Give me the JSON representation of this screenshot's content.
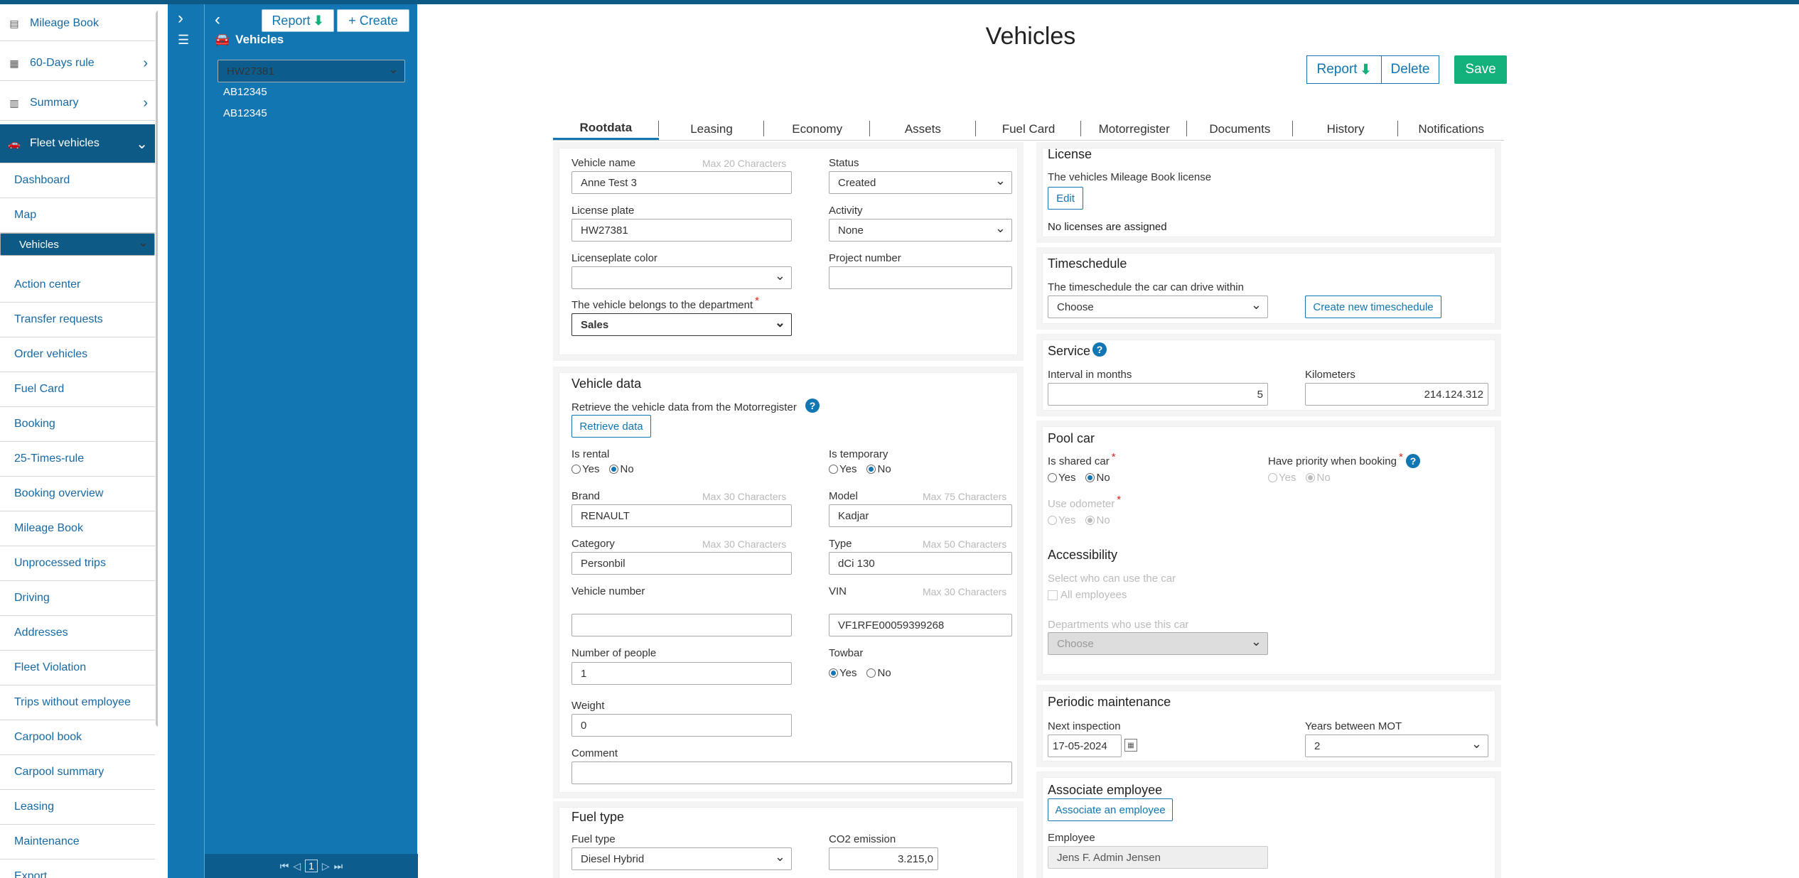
{
  "sidebar": {
    "items": [
      {
        "label": "Mileage Book",
        "icon": "book-icon"
      },
      {
        "label": "60-Days rule",
        "icon": "calendar-60-icon"
      },
      {
        "label": "Summary",
        "icon": "bar-chart-icon"
      },
      {
        "label": "Fleet vehicles",
        "icon": "car-icon"
      }
    ],
    "sub_items": [
      "Dashboard",
      "Map",
      "Vehicles",
      "Action center",
      "Transfer requests",
      "Order vehicles",
      "Fuel Card",
      "Booking",
      "25-Times-rule",
      "Booking overview",
      "Mileage Book",
      "Unprocessed trips",
      "Driving",
      "Addresses",
      "Fleet Violation",
      "Trips without employee",
      "Carpool book",
      "Carpool summary",
      "Leasing",
      "Maintenance",
      "Export"
    ]
  },
  "list_panel": {
    "report_label": "Report",
    "create_label": "+ Create",
    "title": "Vehicles",
    "rows": [
      "HW27381",
      "AB12345",
      "AB12345"
    ],
    "page": "1"
  },
  "main": {
    "title": "Vehicles",
    "report_label": "Report",
    "delete_label": "Delete",
    "save_label": "Save",
    "tabs": [
      "Rootdata",
      "Leasing",
      "Economy",
      "Assets",
      "Fuel Card",
      "Motorregister",
      "Documents",
      "History",
      "Notifications"
    ]
  },
  "rootdata": {
    "vehicle_name_label": "Vehicle name",
    "vehicle_name_hint": "Max 20 Characters",
    "vehicle_name": "Anne Test 3",
    "status_label": "Status",
    "status": "Created",
    "license_plate_label": "License plate",
    "license_plate": "HW27381",
    "activity_label": "Activity",
    "activity": "None",
    "plate_color_label": "Licenseplate color",
    "project_number_label": "Project number",
    "department_label": "The vehicle belongs to the department",
    "department": "Sales"
  },
  "vehicle_data": {
    "title": "Vehicle data",
    "retrieve_text": "Retrieve the vehicle data from the Motorregister",
    "retrieve_btn": "Retrieve data",
    "is_rental_label": "Is rental",
    "is_temporary_label": "Is temporary",
    "yes": "Yes",
    "no": "No",
    "brand_label": "Brand",
    "brand_hint": "Max 30 Characters",
    "brand": "RENAULT",
    "model_label": "Model",
    "model_hint": "Max 75 Characters",
    "model": "Kadjar",
    "category_label": "Category",
    "category_hint": "Max 30 Characters",
    "category": "Personbil",
    "type_label": "Type",
    "type_hint": "Max 50 Characters",
    "type": "dCi 130",
    "vehicle_number_label": "Vehicle number",
    "vin_label": "VIN",
    "vin_hint": "Max 30 Characters",
    "vin": "VF1RFE00059399268",
    "people_label": "Number of people",
    "people": "1",
    "towbar_label": "Towbar",
    "weight_label": "Weight",
    "weight": "0",
    "comment_label": "Comment"
  },
  "fuel": {
    "title": "Fuel type",
    "fuel_type_label": "Fuel type",
    "fuel_type": "Diesel Hybrid",
    "co2_label": "CO2 emission",
    "co2": "3.215,0"
  },
  "license": {
    "title": "License",
    "text": "The vehicles Mileage Book license",
    "edit_btn": "Edit",
    "none_text": "No licenses are assigned"
  },
  "timeschedule": {
    "title": "Timeschedule",
    "text": "The timeschedule the car can drive within",
    "select": "Choose",
    "create_btn": "Create new timeschedule"
  },
  "service": {
    "title": "Service",
    "interval_label": "Interval in months",
    "interval": "5",
    "km_label": "Kilometers",
    "km": "214.124.312"
  },
  "pool": {
    "title": "Pool car",
    "shared_label": "Is shared car",
    "priority_label": "Have priority when booking",
    "odometer_label": "Use odometer"
  },
  "access": {
    "title": "Accessibility",
    "select_text": "Select who can use the car",
    "all_label": "All employees",
    "dept_text": "Departments who use this car",
    "dept_select": "Choose"
  },
  "maintenance": {
    "title": "Periodic maintenance",
    "next_label": "Next inspection",
    "next": "17-05-2024",
    "years_label": "Years between MOT",
    "years": "2"
  },
  "employee": {
    "title": "Associate employee",
    "btn": "Associate an employee",
    "label": "Employee",
    "value": "Jens F. Admin Jensen"
  },
  "colors": {
    "primary": "#1176b1",
    "dark": "#0d5a86",
    "save": "#12b07a",
    "required": "#d9231c"
  }
}
